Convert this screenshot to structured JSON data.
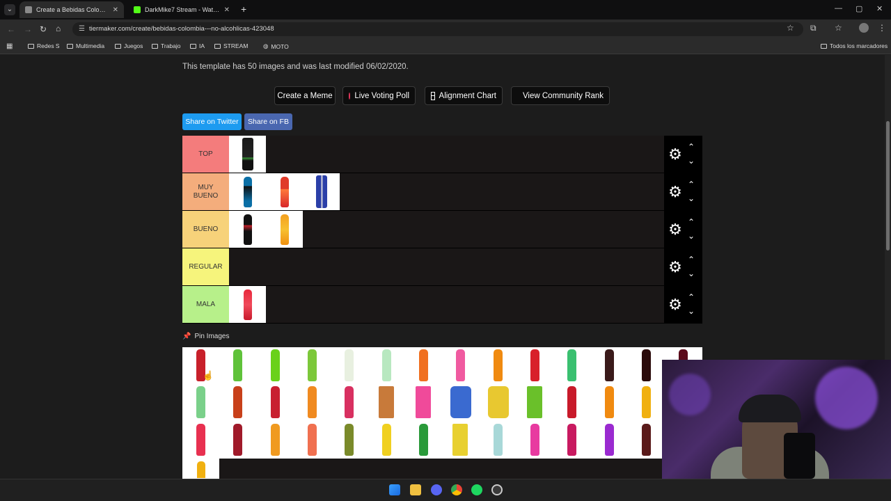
{
  "browser": {
    "tabs": [
      {
        "title": "Create a Bebidas Colombia - N",
        "active": true
      },
      {
        "title": "DarkMike7 Stream - Watch Live",
        "active": false
      }
    ],
    "url": "tiermaker.com/create/bebidas-colombia---no-alcohlicas-423048",
    "bookmarks": [
      "Redes S",
      "Multimedia",
      "Juegos",
      "Trabajo",
      "IA",
      "STREAM",
      "MOTO"
    ],
    "bookmarks_right": "Todos los marcadores"
  },
  "page": {
    "description": "This template has 50 images and was last modified 06/02/2020.",
    "buttons": {
      "create_meme": "Create a Meme",
      "live_poll": "Live Voting Poll",
      "alignment": "Alignment Chart",
      "community": "View Community Rank"
    },
    "share": {
      "twitter": "Share on Twitter",
      "fb": "Share on FB"
    },
    "tiers": [
      {
        "label": "TOP",
        "color": "#f47c7c"
      },
      {
        "label": "MUY BUENO",
        "color": "#f4ad7c"
      },
      {
        "label": "BUENO",
        "color": "#f7d27a"
      },
      {
        "label": "REGULAR",
        "color": "#f6f47c"
      },
      {
        "label": "MALA",
        "color": "#b7f08a"
      }
    ],
    "pin_label": "Pin Images"
  },
  "colors": {
    "twitter": "#1d9bf0",
    "fb": "#4a67b0",
    "accent": "#e0365a"
  }
}
